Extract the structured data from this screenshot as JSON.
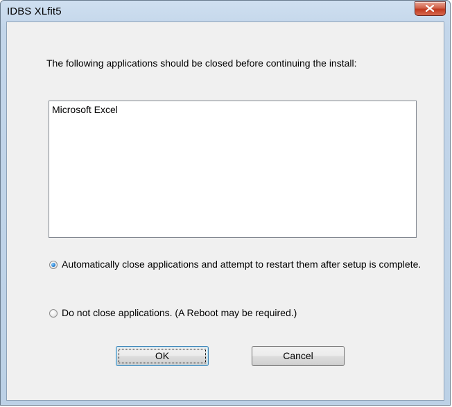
{
  "window": {
    "title": "IDBS XLfit5",
    "close_icon": "close-icon"
  },
  "dialog": {
    "message": "The following applications should be closed before continuing the install:",
    "applications": [
      "Microsoft Excel"
    ],
    "options": {
      "auto_close": {
        "label": "Automatically close applications and attempt to restart them after setup is complete.",
        "checked": true
      },
      "do_not_close": {
        "label": "Do not close applications. (A Reboot may be required.)",
        "checked": false
      }
    },
    "buttons": {
      "ok_label": "OK",
      "cancel_label": "Cancel"
    }
  },
  "colors": {
    "close_button": "#c7432a",
    "radio_selected": "#2a83d6",
    "default_button_border": "#3c7fb1"
  }
}
